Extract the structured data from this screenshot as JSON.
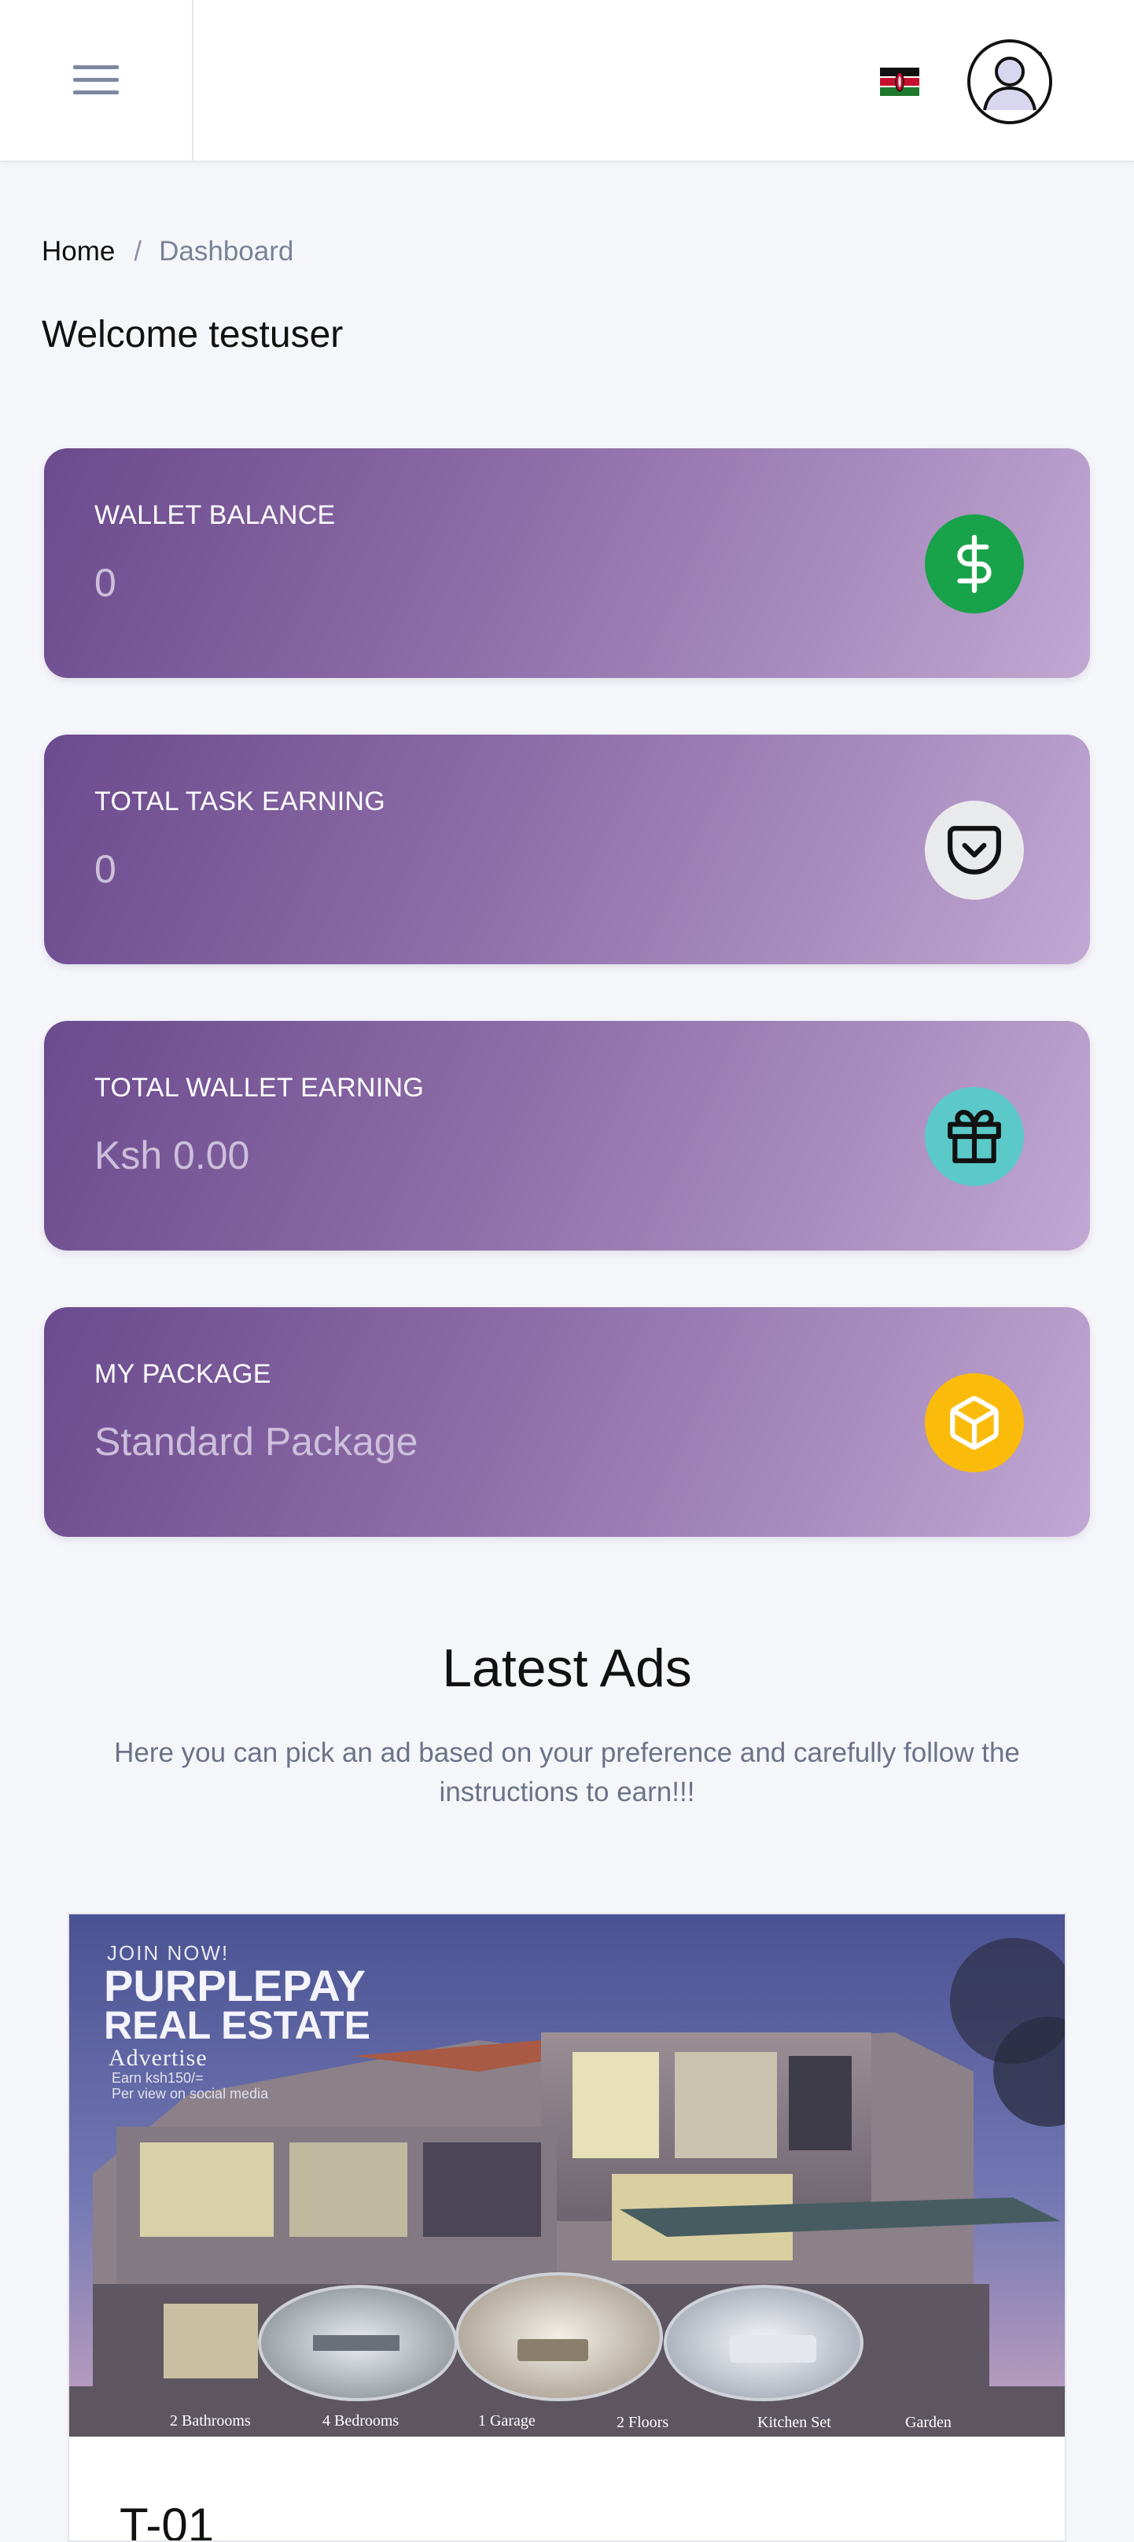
{
  "header": {
    "menu_icon": "hamburger-menu-icon",
    "flag_icon": "kenya-flag-icon",
    "avatar_icon": "user-avatar-icon"
  },
  "breadcrumb": {
    "home": "Home",
    "separator": "/",
    "current": "Dashboard"
  },
  "welcome": "Welcome testuser",
  "cards": [
    {
      "label": "WALLET BALANCE",
      "value": "0",
      "icon": "dollar-icon",
      "icon_bg": "#18a34a"
    },
    {
      "label": "TOTAL TASK EARNING",
      "value": "0",
      "icon": "pocket-icon",
      "icon_bg": "#e9eaec"
    },
    {
      "label": "TOTAL WALLET EARNING",
      "value": "Ksh 0.00",
      "icon": "gift-icon",
      "icon_bg": "#5cc9c9"
    },
    {
      "label": "MY PACKAGE",
      "value": "Standard Package",
      "icon": "package-icon",
      "icon_bg": "#fbbb0a"
    }
  ],
  "ads": {
    "title": "Latest Ads",
    "subtitle": "Here you can pick an ad based on your preference and carefully follow the instructions to earn!!!",
    "items": [
      {
        "title": "T-01",
        "image": {
          "join": "JOIN NOW!",
          "brand_line1": "PURPLEPAY",
          "brand_line2": "REAL ESTATE",
          "advertise": "Advertise",
          "earn": "Earn ksh150/=",
          "per_view": "Per view on social media",
          "features": [
            "2 Bathrooms",
            "4 Bedrooms",
            "1 Garage",
            "2 Floors",
            "Kitchen Set",
            "Garden"
          ]
        }
      }
    ]
  },
  "colors": {
    "card_gradient_start": "#6b4a8e",
    "card_gradient_end": "#c1a8d3",
    "page_bg": "#f5f6fa"
  }
}
